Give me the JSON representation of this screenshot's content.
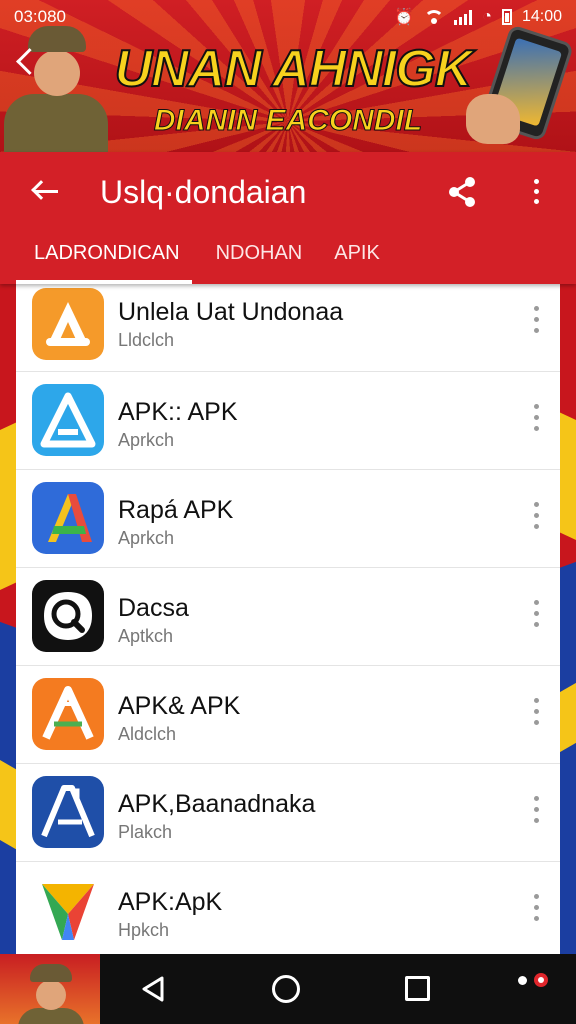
{
  "status_bar": {
    "time": "03:080",
    "clock": "14:00",
    "icons": [
      "alarm-icon",
      "wifi-icon",
      "signal-icon",
      "data-saver-icon",
      "battery-icon"
    ]
  },
  "banner": {
    "title": "UNAN AHNIGK",
    "subtitle": "DIANIN EACONDIL"
  },
  "app_bar": {
    "title": "Uslq·dondaian",
    "tabs": [
      {
        "label": "LADRONDICAN",
        "active": true
      },
      {
        "label": "NDOHAN",
        "active": false
      },
      {
        "label": "APIK",
        "active": false
      }
    ]
  },
  "apps": [
    {
      "name": "Unlela Uat Undonaa",
      "sub": "Lldclch",
      "icon": "orange-a-app-icon"
    },
    {
      "name": "APK:: APK",
      "sub": "Aprkch",
      "icon": "blue-a-app-icon"
    },
    {
      "name": "Rapá APK",
      "sub": "Aprkch",
      "icon": "multicolor-a-app-icon"
    },
    {
      "name": "Dacsa",
      "sub": "Aptkch",
      "icon": "black-search-app-icon"
    },
    {
      "name": "APK& APK",
      "sub": "Aldclch",
      "icon": "orange-a-app-icon"
    },
    {
      "name": "APK,Baanadnaka",
      "sub": "Plakch",
      "icon": "blue-a-app-icon"
    },
    {
      "name": "APK:ApK",
      "sub": "Hpkch",
      "icon": "play-triangle-app-icon"
    }
  ],
  "colors": {
    "primary": "#d32027",
    "banner_yellow": "#f7d21e",
    "accent_blue": "#1b3ea1",
    "list_bg": "#ffffff",
    "nav_bg": "#0f0f0f"
  }
}
